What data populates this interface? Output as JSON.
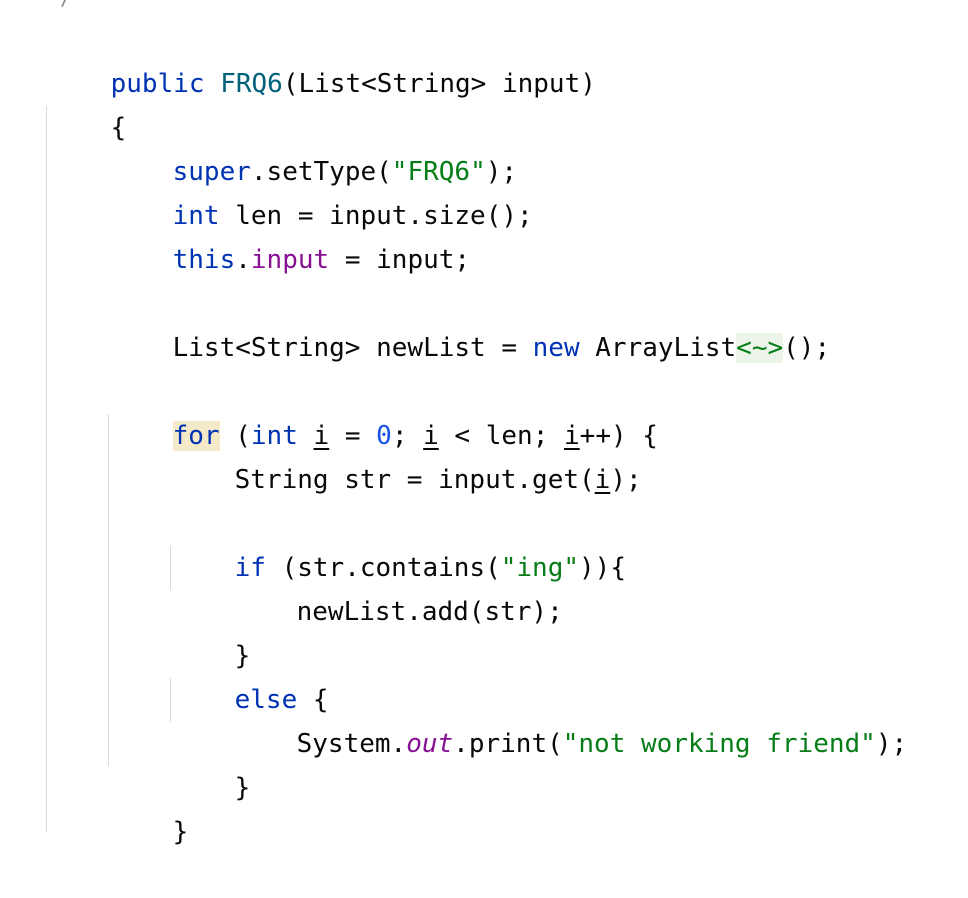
{
  "editor": {
    "top_stub": "*/",
    "lines": {
      "l1": [
        "public",
        " ",
        "FRQ6",
        "(List<String> input)"
      ],
      "l2": "{",
      "l3": [
        "super",
        ".setType(",
        "\"FRQ6\"",
        ");"
      ],
      "l4": [
        "int",
        " len = input.size();"
      ],
      "l5": [
        "this",
        ".",
        "input",
        " = input;"
      ],
      "l6": [
        "List<String> newList = ",
        "new",
        " ArrayList",
        "<~>",
        "();"
      ],
      "l7": [
        "for",
        " (",
        "int",
        " ",
        "i",
        " = ",
        "0",
        "; ",
        "i",
        " < len; ",
        "i",
        "++) {"
      ],
      "l8": [
        "String str = input.get(",
        "i",
        ");"
      ],
      "l9": [
        "if",
        " (str.contains(",
        "\"ing\"",
        ")){"
      ],
      "l10": "newList.add(str);",
      "l11": "}",
      "l12": [
        "else",
        " {"
      ],
      "l13": [
        "System.",
        "out",
        ".print(",
        "\"not working friend\"",
        ");"
      ],
      "l14": "}",
      "l15": "}"
    }
  },
  "colors": {
    "keyword": "#0033b3",
    "class_name": "#00627a",
    "string": "#067d17",
    "number": "#1750eb",
    "field": "#871094",
    "text": "#080808",
    "keyword_highlight_bg": "#f5eac8",
    "diamond_highlight_bg": "#edf5ea",
    "indent_guide": "#d9d9d9"
  }
}
